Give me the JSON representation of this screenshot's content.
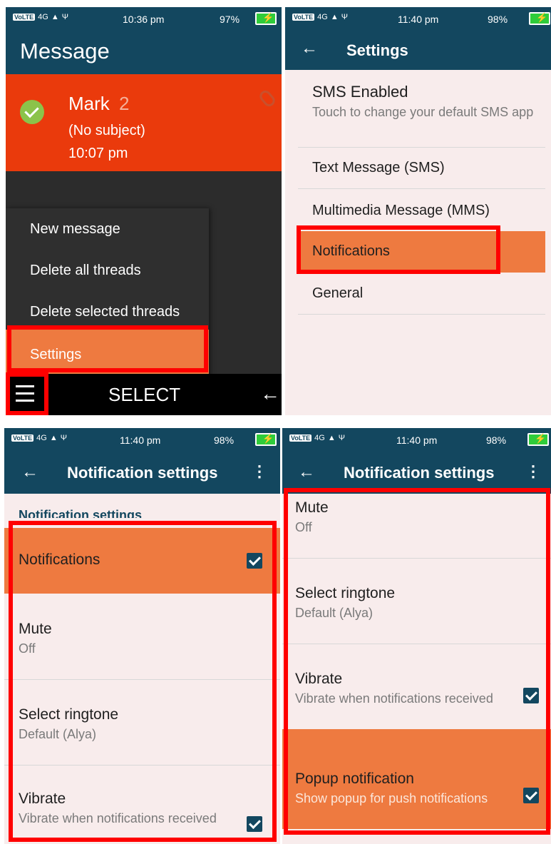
{
  "colors": {
    "primary": "#13475f",
    "highlight": "#ee7a40",
    "thread": "#ea3a0c",
    "annotation": "#ff0000",
    "settings_bg": "#f8ecec"
  },
  "panel1": {
    "status": {
      "volte": "VoLTE",
      "network": "4G",
      "time": "10:36 pm",
      "battery": "97%"
    },
    "title": "Message",
    "thread": {
      "name": "Mark",
      "count": "2",
      "subject": "(No subject)",
      "time": "10:07 pm"
    },
    "menu": [
      "New message",
      "Delete all threads",
      "Delete selected threads",
      "Settings"
    ],
    "bottom": {
      "center": "SELECT"
    }
  },
  "panel2": {
    "status": {
      "volte": "VoLTE",
      "network": "4G",
      "time": "11:40 pm",
      "battery": "98%"
    },
    "title": "Settings",
    "items": [
      {
        "title": "SMS Enabled",
        "subtitle": "Touch to change your default SMS app"
      },
      {
        "title": "Text Message (SMS)"
      },
      {
        "title": "Multimedia Message (MMS)"
      },
      {
        "title": "Notifications"
      },
      {
        "title": "General"
      }
    ]
  },
  "panel3": {
    "status": {
      "volte": "VoLTE",
      "network": "4G",
      "time": "11:40 pm",
      "battery": "98%"
    },
    "title": "Notification settings",
    "section": "Notification settings",
    "items": [
      {
        "title": "Notifications",
        "checked": true
      },
      {
        "title": "Mute",
        "subtitle": "Off"
      },
      {
        "title": "Select ringtone",
        "subtitle": "Default (Alya)"
      },
      {
        "title": "Vibrate",
        "subtitle": "Vibrate when notifications received",
        "checked": true
      }
    ]
  },
  "panel4": {
    "status": {
      "volte": "VoLTE",
      "network": "4G",
      "time": "11:40 pm",
      "battery": "98%"
    },
    "title": "Notification settings",
    "items": [
      {
        "title": "Mute",
        "subtitle": "Off"
      },
      {
        "title": "Select ringtone",
        "subtitle": "Default (Alya)"
      },
      {
        "title": "Vibrate",
        "subtitle": "Vibrate when notifications received",
        "checked": true
      },
      {
        "title": "Popup notification",
        "subtitle": "Show popup for push notifications",
        "checked": true
      }
    ]
  }
}
